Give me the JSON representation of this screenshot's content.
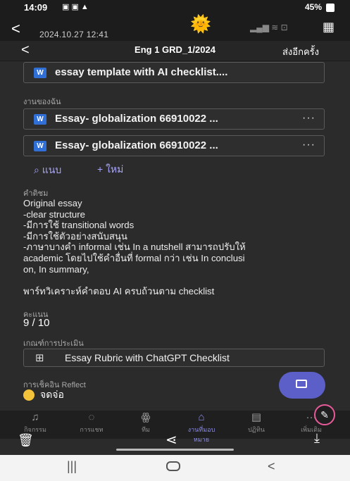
{
  "status_bar": {
    "time": "14:09",
    "left_icons": "▣ ▣ ▲",
    "battery": "45%"
  },
  "viewer": {
    "timestamp": "2024.10.27 12:41",
    "sun_emoji": "🌞"
  },
  "header": {
    "back_icon": "chevron-left-icon",
    "title": "Eng 1 GRD_1/2024",
    "action": "ส่งอีกครั้ง"
  },
  "attachments": {
    "template": "essay template with AI checklist....",
    "my_work_label": "งานของฉัน",
    "files": [
      {
        "name": "Essay- globalization 66910022 ...",
        "more": "···"
      },
      {
        "name": "Essay- globalization 66910022 ...",
        "more": "···"
      }
    ],
    "attach_label": "แนบ",
    "new_label": "ใหม่"
  },
  "comment": {
    "label": "คำติชม",
    "lines": [
      "Original essay",
      "-clear structure",
      "-มีการใช้ transitional words",
      "-มีการใช้ตัวอย่างสนับสนุน",
      "-ภาษาบางคำ informal เช่น In a nutshell สามารถปรับให้",
      "academic โดยไปใช้คำอื่นที่ formal กว่า เช่น In conclusi",
      "on, In summary,",
      "",
      "พาร์ทวิเคราะห์คำตอบ AI ครบถ้วนตาม checklist"
    ]
  },
  "score": {
    "label": "คะแนน",
    "value": "9 / 10"
  },
  "rubric": {
    "label": "เกณฑ์การประเมิน",
    "title": "Essay Rubric with ChatGPT Checklist"
  },
  "reflect": {
    "label": "การเช็คอิน Reflect",
    "value": "จดจ่อ"
  },
  "bottom_nav": [
    {
      "label": "กิจกรรม",
      "icon": "bell-icon"
    },
    {
      "label": "การแชท",
      "icon": "chat-icon"
    },
    {
      "label": "ทีม",
      "icon": "teams-icon"
    },
    {
      "label": "งานที่มอบหมาย",
      "icon": "assignment-icon",
      "active": true
    },
    {
      "label": "ปฏิทิน",
      "icon": "calendar-icon"
    },
    {
      "label": "เพิ่มเติม",
      "icon": "more-icon"
    }
  ],
  "colors": {
    "accent": "#5b5fc7",
    "link": "#a7a4ff",
    "background": "#2b2b2b"
  }
}
